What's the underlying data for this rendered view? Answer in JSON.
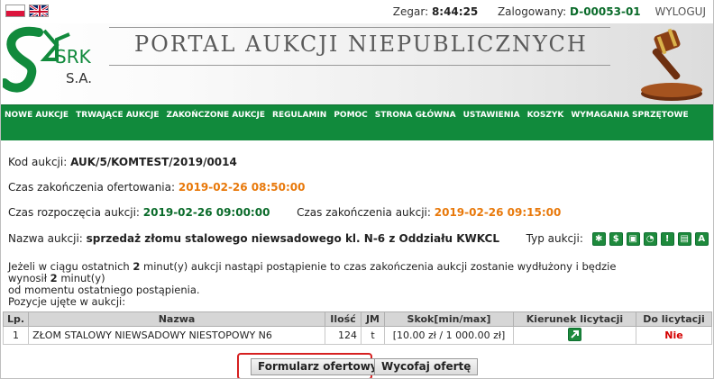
{
  "topbar": {
    "clock_label": "Zegar:",
    "clock_value": "8:44:25",
    "user_label": "Zalogowany:",
    "user_value": "D-00053-01",
    "logout": "WYLOGUJ"
  },
  "header": {
    "logo_text": "SRK",
    "logo_suffix": "S.A.",
    "title": "PORTAL AUKCJI NIEPUBLICZNYCH"
  },
  "nav": {
    "items": [
      "NOWE AUKCJE",
      "TRWAJĄCE AUKCJE",
      "ZAKOŃCZONE AUKCJE",
      "REGULAMIN",
      "POMOC",
      "STRONA GŁÓWNA",
      "USTAWIENIA",
      "KOSZYK",
      "WYMAGANIA SPRZĘTOWE"
    ]
  },
  "auction": {
    "code_label": "Kod aukcji:",
    "code_value": "AUK/5/KOMTEST/2019/0014",
    "offer_end_label": "Czas zakończenia ofertowania:",
    "offer_end_value": "2019-02-26 08:50:00",
    "start_label": "Czas rozpoczęcia aukcji:",
    "start_value": "2019-02-26 09:00:00",
    "end_label": "Czas zakończenia aukcji:",
    "end_value": "2019-02-26 09:15:00",
    "name_label": "Nazwa aukcji:",
    "name_value": "sprzedaż złomu stalowego niewsadowego kl. N-6 z Oddziału KWKCL",
    "type_label": "Typ aukcji:",
    "type_icons": [
      "grid-icon",
      "dollar-icon",
      "lock-icon",
      "clock-icon",
      "info-icon",
      "card-icon",
      "letter-a-icon"
    ],
    "type_glyphs": [
      "✱",
      "$",
      "▣",
      "◔",
      "!",
      "▤",
      "A"
    ],
    "note_line1_a": "Jeżeli w ciągu ostatnich ",
    "note_line1_b": "2",
    "note_line1_c": " minut(y) aukcji nastąpi postąpienie to czas zakończenia aukcji zostanie wydłużony i będzie wynosił ",
    "note_line1_d": "2",
    "note_line1_e": " minut(y)",
    "note_line2": "od momentu ostatniego postąpienia.",
    "note_line3": "Pozycje ujęte w aukcji:"
  },
  "table": {
    "headers": [
      "Lp.",
      "Nazwa",
      "Ilość",
      "JM",
      "Skok[min/max]",
      "Kierunek licytacji",
      "Do licytacji"
    ],
    "rows": [
      {
        "lp": "1",
        "name": "ZŁOM STALOWY NIEWSADOWY NIESTOPOWY N6",
        "qty": "124",
        "unit": "t",
        "step": "[10.00 zł / 1 000.00 zł]",
        "direction_icon": "arrow-up-right-icon",
        "bid": "Nie"
      }
    ]
  },
  "buttons": {
    "form": "Formularz ofertowy",
    "withdraw": "Wycofaj ofertę"
  },
  "colors": {
    "brand_green": "#118a3c",
    "highlight_orange": "#e8790b",
    "alert_red": "#d40000"
  }
}
